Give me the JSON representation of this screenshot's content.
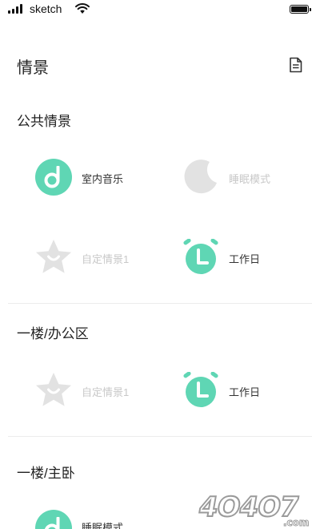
{
  "status_bar": {
    "carrier": "sketch"
  },
  "header": {
    "title": "情景"
  },
  "sections": [
    {
      "title": "公共情景",
      "scenes": [
        {
          "label": "室内音乐",
          "icon": "music-note-icon",
          "active": true
        },
        {
          "label": "睡眠模式",
          "icon": "moon-icon",
          "active": false
        },
        {
          "label": "自定情景1",
          "icon": "star-icon",
          "active": false
        },
        {
          "label": "工作日",
          "icon": "alarm-clock-icon",
          "active": true
        }
      ]
    },
    {
      "title": "一楼/办公区",
      "scenes": [
        {
          "label": "自定情景1",
          "icon": "star-icon",
          "active": false
        },
        {
          "label": "工作日",
          "icon": "alarm-clock-icon",
          "active": true
        }
      ]
    },
    {
      "title": "一楼/主卧",
      "scenes": [
        {
          "label": "睡眠模式",
          "icon": "music-note-icon",
          "active": true
        }
      ]
    }
  ],
  "watermark": {
    "text": "4O4O7.com"
  },
  "colors": {
    "accent": "#5fd6b4",
    "inactive": "#e2e2e2",
    "inactive_text": "#c8c8c8"
  }
}
